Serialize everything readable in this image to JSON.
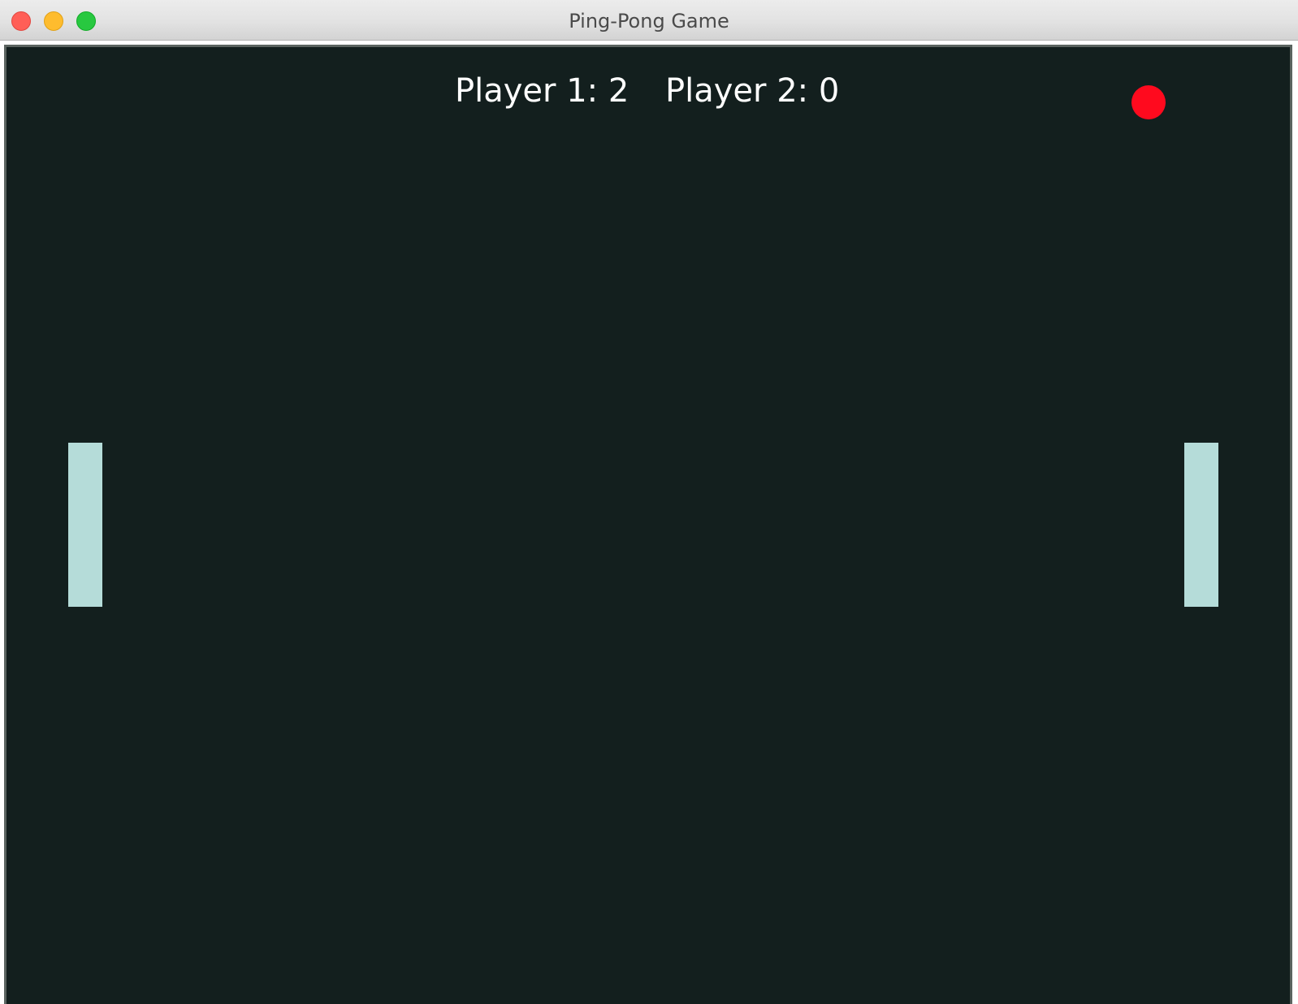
{
  "window": {
    "title": "Ping-Pong Game"
  },
  "scoreboard": {
    "player1": "Player 1: 2",
    "player2": "Player 2: 0"
  },
  "colors": {
    "background": "#131f1e",
    "ball": "#ff0a1e",
    "paddle": "#b5dcd9",
    "text": "#ffffff"
  }
}
